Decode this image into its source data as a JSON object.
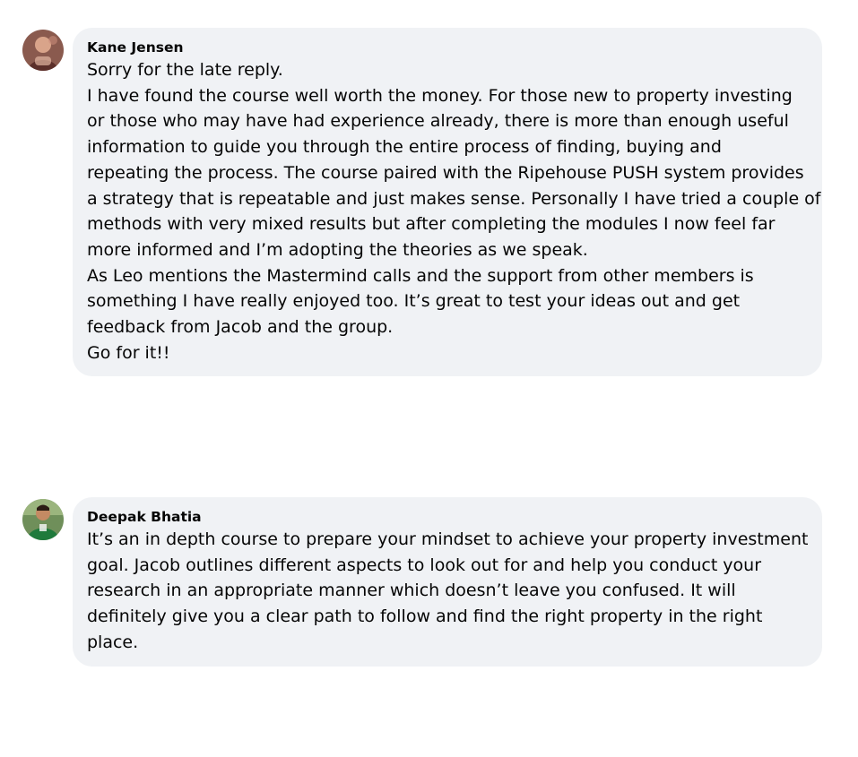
{
  "comments": [
    {
      "author": "Kane Jensen",
      "lines": [
        "Sorry for the late reply.",
        "I have found the course well worth the money. For those new to property investing",
        "or those who may have had experience already, there is more than enough useful",
        "information to guide you through the entire process of finding, buying and",
        "repeating the process. The course paired with the Ripehouse PUSH system provides",
        "a strategy that is repeatable and just makes sense. Personally I have tried a couple of",
        "methods with very mixed results but after completing the modules I now feel far",
        "more informed and I’m adopting the theories as we speak.",
        "As Leo mentions the Mastermind calls and the support from other members is",
        "something I have really enjoyed too. It’s great to test your ideas out and get",
        "feedback from Jacob and the group.",
        "Go for it!!"
      ]
    },
    {
      "author": "Deepak Bhatia",
      "lines": [
        "It’s an in depth course to prepare your mindset to achieve your property investment",
        "goal. Jacob outlines different aspects to look out for and help you conduct your",
        "research in an appropriate manner which doesn’t leave you confused. It will",
        "definitely give you a clear path to follow and find the right property in the right",
        "place."
      ]
    }
  ],
  "colors": {
    "bubble_bg": "#f0f2f5",
    "text": "#050505",
    "page_bg": "#ffffff"
  }
}
